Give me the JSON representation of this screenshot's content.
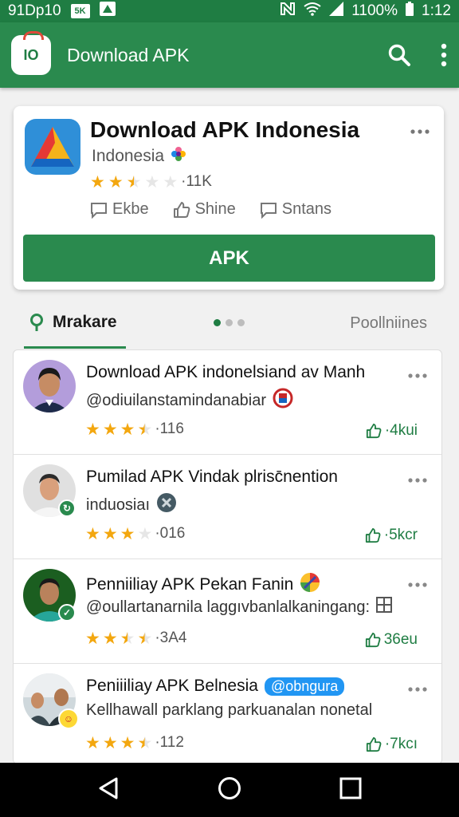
{
  "status_bar": {
    "left_text": "91Dp10",
    "badge_1": "5K",
    "battery": "1100%",
    "time": "1:12"
  },
  "app_bar": {
    "logo_text": "IO",
    "title": "Download APK",
    "icons": [
      "search-icon",
      "more-vert-icon"
    ]
  },
  "featured": {
    "title": "Download APK  Indonesia",
    "subtitle": "Indonesia",
    "rating": 2.5,
    "rating_count": "·11K",
    "actions": [
      {
        "icon": "comment-icon",
        "label": "Ekbe"
      },
      {
        "icon": "thumb-up-icon",
        "label": "Shine"
      },
      {
        "icon": "comment-icon",
        "label": "Sntans"
      }
    ],
    "button_label": "APK"
  },
  "tabs": {
    "left_label": "Mrakare",
    "right_label": "Poollniines",
    "active_dot": 0,
    "dot_count": 3
  },
  "list": [
    {
      "title": "Download APK indonelsiand av Manh",
      "subtitle": "@odiuilanstamindanabiar",
      "rating": 3.5,
      "count": "·116",
      "likes": "·4kui"
    },
    {
      "title": "Pumilad APK Vindak plrisc̄nention",
      "subtitle": "induosiaı",
      "rating": 3,
      "count": "·016",
      "likes": "·5kcr"
    },
    {
      "title": "Penniiliay APK Pekan Fanin",
      "subtitle": "@oullartanarnila laggıvbanlalkaningang:",
      "rating": 2.5,
      "count": "·3A4",
      "likes": "36eu"
    },
    {
      "title": "Peniiiliay APK  Belnesia",
      "tag": "@obngura",
      "subtitle": "Kellhawall parklang parkuanalan nonetal",
      "rating": 3.5,
      "count": "·112",
      "likes": "·7kcı"
    }
  ],
  "colors": {
    "primary": "#2a8a4e",
    "status_bar": "#1f7d43",
    "star": "#f3a70f",
    "tag": "#2196f3"
  }
}
